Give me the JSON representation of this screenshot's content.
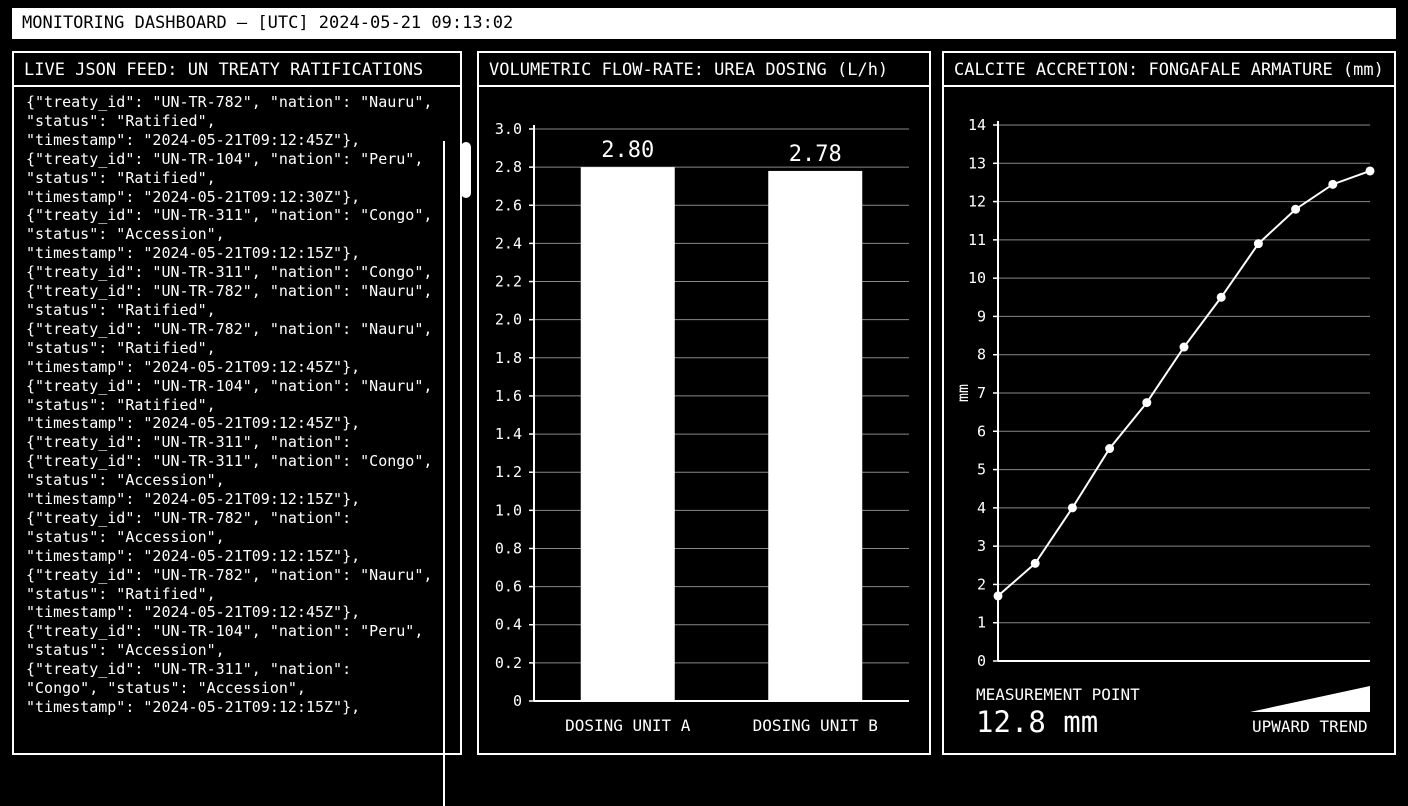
{
  "header": {
    "title": "MONITORING DASHBOARD – [UTC] 2024-05-21 09:13:02"
  },
  "feed_panel": {
    "title": "LIVE JSON FEED: UN TREATY RATIFICATIONS",
    "lines": [
      "{\"treaty_id\": \"UN-TR-782\", \"nation\": \"Nauru\",",
      "\"status\": \"Ratified\",",
      "\"timestamp\": \"2024-05-21T09:12:45Z\"},",
      "{\"treaty_id\": \"UN-TR-104\", \"nation\": \"Peru\",",
      "\"status\": \"Ratified\",",
      "\"timestamp\": \"2024-05-21T09:12:30Z\"},",
      "{\"treaty_id\": \"UN-TR-311\", \"nation\": \"Congo\",",
      "\"status\": \"Accession\",",
      "\"timestamp\": \"2024-05-21T09:12:15Z\"},",
      "{\"treaty_id\": \"UN-TR-311\", \"nation\": \"Congo\",",
      "{\"treaty_id\": \"UN-TR-782\", \"nation\": \"Nauru\",",
      "\"status\": \"Ratified\",",
      "{\"treaty_id\": \"UN-TR-782\", \"nation\": \"Nauru\",",
      "\"status\": \"Ratified\",",
      "\"timestamp\": \"2024-05-21T09:12:45Z\"},",
      "{\"treaty_id\": \"UN-TR-104\", \"nation\": \"Nauru\",",
      "\"status\": \"Ratified\",",
      "\"timestamp\": \"2024-05-21T09:12:45Z\"},",
      "{\"treaty_id\": \"UN-TR-311\", \"nation\":",
      "{\"treaty_id\": \"UN-TR-311\", \"nation\": \"Congo\",",
      "\"status\": \"Accession\",",
      "\"timestamp\": \"2024-05-21T09:12:15Z\"},",
      "{\"treaty_id\": \"UN-TR-782\", \"nation\":",
      "\"status\": \"Accession\",",
      "\"timestamp\": \"2024-05-21T09:12:15Z\"},",
      "{\"treaty_id\": \"UN-TR-782\", \"nation\": \"Nauru\",",
      "\"status\": \"Ratified\",",
      "\"timestamp\": \"2024-05-21T09:12:45Z\"},",
      "{\"treaty_id\": \"UN-TR-104\", \"nation\": \"Peru\",",
      "\"status\": \"Accession\",",
      "{\"treaty_id\": \"UN-TR-311\", \"nation\":",
      "\"Congo\", \"status\": \"Accession\",",
      "\"timestamp\": \"2024-05-21T09:12:15Z\"},"
    ]
  },
  "bar_panel": {
    "title": "VOLUMETRIC FLOW-RATE: UREA DOSING (L/h)"
  },
  "line_panel": {
    "title": "CALCITE ACCRETION: FONGAFALE ARMATURE (mm)",
    "measurement_label": "MEASUREMENT POINT",
    "measurement_value": "12.8 mm",
    "trend_label": "UPWARD TREND"
  },
  "chart_data": [
    {
      "type": "bar",
      "title": "VOLUMETRIC FLOW-RATE: UREA DOSING (L/h)",
      "categories": [
        "DOSING UNIT A",
        "DOSING UNIT B"
      ],
      "values": [
        2.8,
        2.78
      ],
      "value_labels": [
        "2.80",
        "2.78"
      ],
      "ylim": [
        0,
        3.0
      ],
      "yticks": [
        "0",
        "0.2",
        "0.4",
        "0.6",
        "0.8",
        "1.0",
        "1.2",
        "1.4",
        "1.6",
        "1.8",
        "2.0",
        "2.2",
        "2.4",
        "2.6",
        "2.8",
        "3.0"
      ],
      "grid": true,
      "colors": {
        "bar": "#ffffff",
        "background": "#000000"
      }
    },
    {
      "type": "line",
      "title": "CALCITE ACCRETION: FONGAFALE ARMATURE (mm)",
      "ylabel": "mm",
      "ylim": [
        0,
        14
      ],
      "yticks": [
        "0",
        "1",
        "2",
        "3",
        "4",
        "5",
        "6",
        "7",
        "8",
        "9",
        "10",
        "11",
        "12",
        "13",
        "14"
      ],
      "values": [
        1.7,
        2.55,
        4.0,
        5.55,
        6.75,
        8.2,
        9.5,
        10.9,
        11.8,
        12.45,
        12.8
      ],
      "grid": true,
      "colors": {
        "line": "#ffffff",
        "background": "#000000"
      }
    }
  ]
}
